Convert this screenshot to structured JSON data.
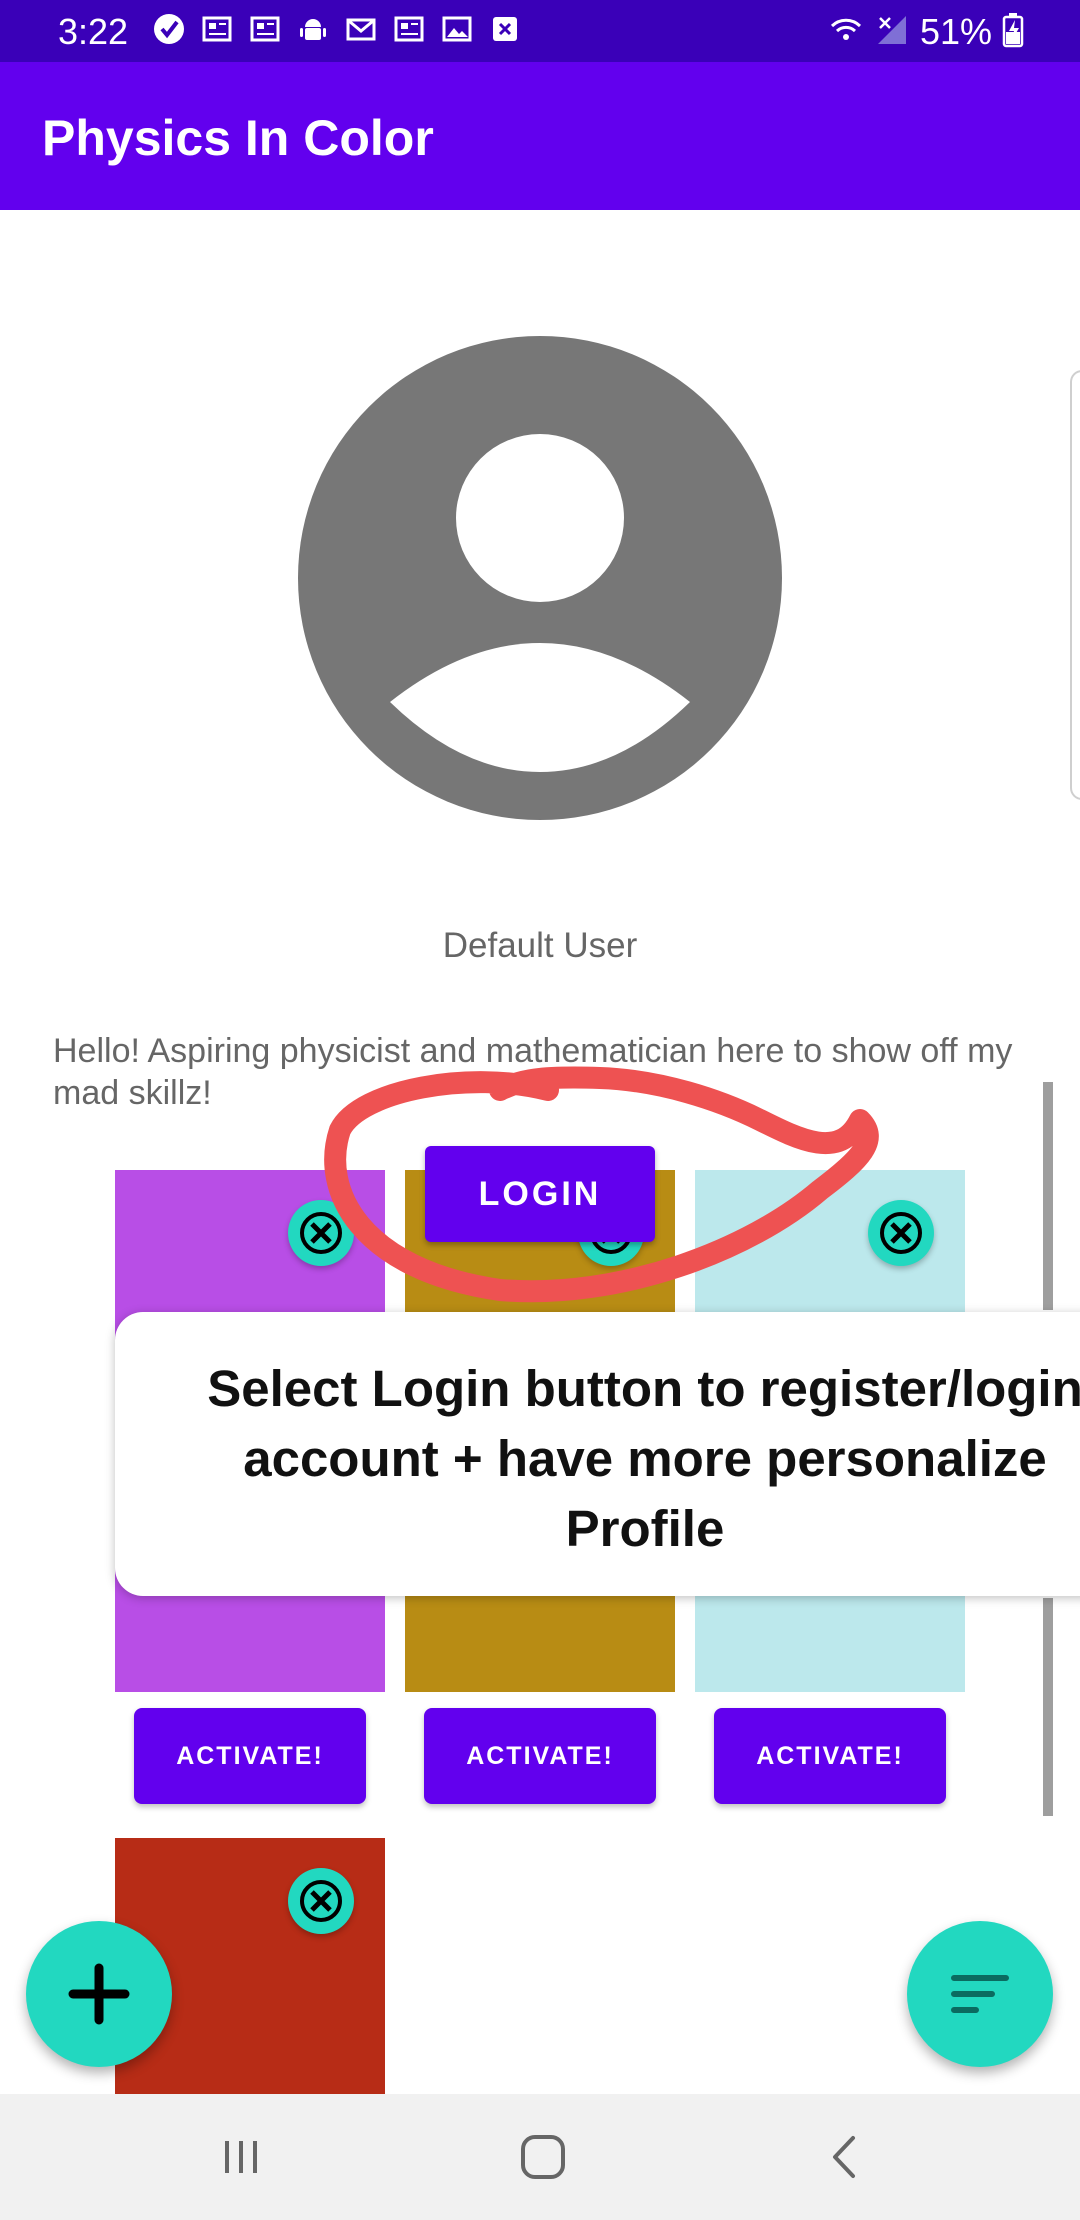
{
  "status_bar": {
    "time": "3:22",
    "battery": "51%",
    "icons": [
      "check-circle-icon",
      "news-icon",
      "news-icon",
      "android-icon",
      "gmail-icon",
      "news-icon",
      "image-icon",
      "close-box-icon"
    ]
  },
  "app_bar": {
    "title": "Physics In Color"
  },
  "profile": {
    "name": "Default User",
    "bio": "Hello! Aspiring physicist and mathematician here to show off my mad skillz!"
  },
  "login_button": {
    "label": "LOGIN"
  },
  "tooltip": {
    "lines": [
      "Select Login button to register/login",
      "account + have more personalize",
      "Profile"
    ]
  },
  "cards": [
    {
      "color": "#b84ee6",
      "button": "ACTIVATE!"
    },
    {
      "color": "#b88c14",
      "button": "ACTIVATE!"
    },
    {
      "color": "#bce8ec",
      "button": "ACTIVATE!"
    },
    {
      "color": "#b72c16"
    }
  ],
  "colors": {
    "primary": "#6200ee",
    "status": "#3a00b8",
    "accent": "#22d8c0",
    "annotation": "#ee5252"
  }
}
